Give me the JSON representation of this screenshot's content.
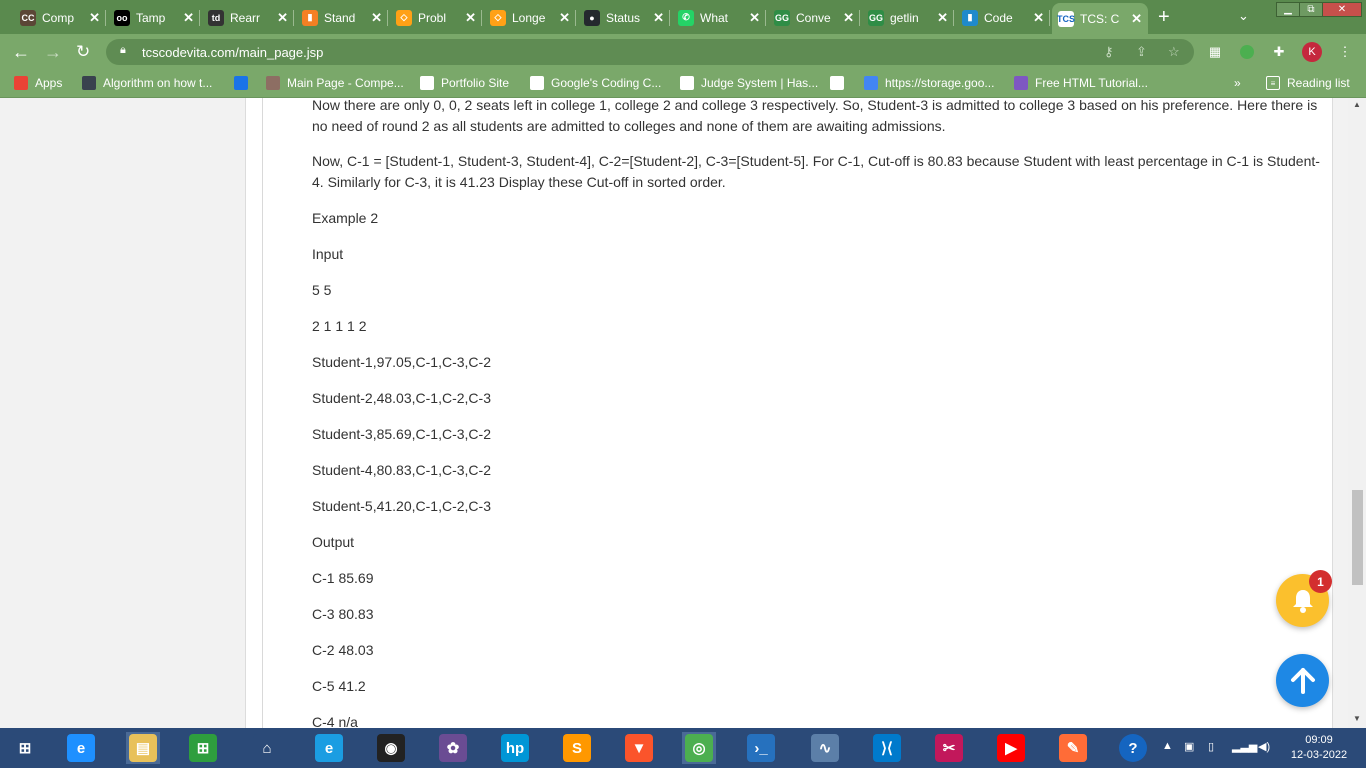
{
  "browser": {
    "tabs": [
      {
        "icon": "codechef-icon",
        "title": "Comp",
        "color": "#5b4636",
        "glyph": "CC"
      },
      {
        "icon": "tampermonkey-icon",
        "title": "Tamp",
        "color": "#000000",
        "glyph": "oo"
      },
      {
        "icon": "td-icon",
        "title": "Rearr",
        "color": "#333333",
        "glyph": "td"
      },
      {
        "icon": "stackoverflow-icon",
        "title": "Stand",
        "color": "#f48024",
        "glyph": "▮"
      },
      {
        "icon": "leetcode-icon",
        "title": "Probl",
        "color": "#ffa116",
        "glyph": "◇"
      },
      {
        "icon": "leetcode-icon",
        "title": "Longe",
        "color": "#ffa116",
        "glyph": "◇"
      },
      {
        "icon": "github-icon",
        "title": "Status",
        "color": "#24292e",
        "glyph": "●"
      },
      {
        "icon": "whatsapp-icon",
        "title": "What",
        "color": "#25d366",
        "glyph": "✆"
      },
      {
        "icon": "geeksforgeeks-icon",
        "title": "Conve",
        "color": "#2f8d46",
        "glyph": "GG"
      },
      {
        "icon": "geeksforgeeks-icon",
        "title": "getlin",
        "color": "#2f8d46",
        "glyph": "GG"
      },
      {
        "icon": "codeforces-icon",
        "title": "Code",
        "color": "#1f8acb",
        "glyph": "▮"
      },
      {
        "icon": "tcs-icon",
        "title": "TCS: C",
        "color": "#ffffff",
        "glyph": "TCS"
      }
    ],
    "url": "tcscodevita.com/main_page.jsp",
    "profile_initial": "K",
    "bookmarks": [
      {
        "icon": "apps-icon",
        "label": "Apps",
        "color": "#ea4335"
      },
      {
        "icon": "hackerrank-icon",
        "label": "Algorithm on how t...",
        "color": "#39424e"
      },
      {
        "icon": "bookmark-icon",
        "label": "",
        "color": "#1a73e8"
      },
      {
        "icon": "codevita-icon",
        "label": "Main Page - Compe...",
        "color": "#8d6e63"
      },
      {
        "icon": "page-icon",
        "label": "Portfolio Site",
        "color": "#ffffff"
      },
      {
        "icon": "google-icon",
        "label": "Google's Coding C...",
        "color": "#ffffff"
      },
      {
        "icon": "google-icon",
        "label": "Judge System | Has...",
        "color": "#ffffff"
      },
      {
        "icon": "wikipedia-icon",
        "label": "",
        "color": "#ffffff"
      },
      {
        "icon": "docs-icon",
        "label": "https://storage.goo...",
        "color": "#4285f4"
      },
      {
        "icon": "w3-icon",
        "label": "Free HTML Tutorial...",
        "color": "#7e57c2"
      }
    ],
    "more_bookmarks": "»",
    "reading_list": "Reading list"
  },
  "page": {
    "paragraphs": [
      "Now there are only 0, 0, 2 seats left in college 1, college 2 and college 3 respectively. So, Student-3 is admitted to college 3 based on his preference. Here there is no need of round 2 as all students are admitted to colleges and none of them are awaiting admissions.",
      "Now, C-1 = [Student-1, Student-3, Student-4], C-2=[Student-2], C-3=[Student-5]. For C-1, Cut-off is 80.83 because Student with least percentage in C-1 is Student-4. Similarly for C-3, it is 41.23 Display these Cut-off in sorted order.",
      "Example 2",
      "Input",
      "5 5",
      "2 1 1 1 2",
      "Student-1,97.05,C-1,C-3,C-2",
      "Student-2,48.03,C-1,C-2,C-3",
      "Student-3,85.69,C-1,C-3,C-2",
      "Student-4,80.83,C-1,C-3,C-2",
      "Student-5,41.20,C-1,C-2,C-3",
      "Output",
      "C-1 85.69",
      "C-3 80.83",
      "C-2 48.03",
      "C-5 41.2",
      "C-4 n/a"
    ],
    "notification_count": "1"
  },
  "taskbar": {
    "apps": [
      {
        "icon": "start-icon",
        "color": "#2b4a78",
        "glyph": "⊞"
      },
      {
        "icon": "internet-explorer-icon",
        "color": "#1e90ff",
        "glyph": "e"
      },
      {
        "icon": "file-explorer-icon",
        "color": "#e8c15a",
        "glyph": "▤"
      },
      {
        "icon": "store-icon",
        "color": "#2e9e3e",
        "glyph": "⊞"
      },
      {
        "icon": "home-icon",
        "color": "#2b4a78",
        "glyph": "⌂"
      },
      {
        "icon": "edge-icon",
        "color": "#1b9de2",
        "glyph": "e"
      },
      {
        "icon": "webcam-icon",
        "color": "#222222",
        "glyph": "◉"
      },
      {
        "icon": "photos-icon",
        "color": "#6a4c93",
        "glyph": "✿"
      },
      {
        "icon": "hp-icon",
        "color": "#0096d6",
        "glyph": "hp"
      },
      {
        "icon": "sublime-icon",
        "color": "#ff9800",
        "glyph": "S"
      },
      {
        "icon": "brave-icon",
        "color": "#fb542b",
        "glyph": "▼"
      },
      {
        "icon": "chrome-icon",
        "color": "#4caf50",
        "glyph": "◎"
      },
      {
        "icon": "powershell-icon",
        "color": "#2671be",
        "glyph": "›_"
      },
      {
        "icon": "performance-monitor-icon",
        "color": "#5c7fa8",
        "glyph": "∿"
      },
      {
        "icon": "vscode-icon",
        "color": "#007acc",
        "glyph": "⟩⟨"
      },
      {
        "icon": "snipping-tool-icon",
        "color": "#c2185b",
        "glyph": "✂"
      },
      {
        "icon": "youtube-icon",
        "color": "#ff0000",
        "glyph": "▶"
      },
      {
        "icon": "postman-icon",
        "color": "#ff6c37",
        "glyph": "✎"
      },
      {
        "icon": "help-icon",
        "color": "#1565c0",
        "glyph": "?"
      }
    ],
    "time": "09:09",
    "date": "12-03-2022"
  }
}
